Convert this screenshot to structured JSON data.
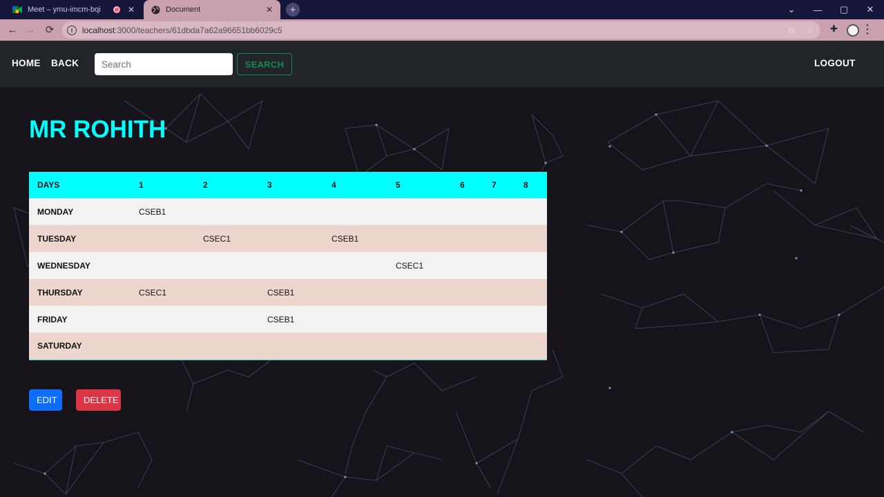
{
  "browser": {
    "tabs": [
      {
        "title": "Meet – ymu-imcm-bqi",
        "active": false
      },
      {
        "title": "Document",
        "active": true
      }
    ],
    "url_host": "localhost",
    "url_path": ":3000/teachers/61dbda7a62a96651bb6029c5"
  },
  "navbar": {
    "home": "HOME",
    "back": "BACK",
    "search_placeholder": "Search",
    "search_button": "SEARCH",
    "logout": "LOGOUT"
  },
  "page": {
    "title": "MR ROHITH"
  },
  "timetable": {
    "headers": [
      "DAYS",
      "1",
      "2",
      "3",
      "4",
      "5",
      "6",
      "7",
      "8"
    ],
    "rows": [
      {
        "day": "MONDAY",
        "periods": [
          "CSEB1",
          "",
          "",
          "",
          "",
          "",
          "",
          ""
        ]
      },
      {
        "day": "TUESDAY",
        "periods": [
          "",
          "CSEC1",
          "",
          "CSEB1",
          "",
          "",
          "",
          ""
        ]
      },
      {
        "day": "WEDNESDAY",
        "periods": [
          "",
          "",
          "",
          "",
          "CSEC1",
          "",
          "",
          ""
        ]
      },
      {
        "day": "THURSDAY",
        "periods": [
          "CSEC1",
          "",
          "CSEB1",
          "",
          "",
          "",
          "",
          ""
        ]
      },
      {
        "day": "FRIDAY",
        "periods": [
          "",
          "",
          "CSEB1",
          "",
          "",
          "",
          "",
          ""
        ]
      },
      {
        "day": "SATURDAY",
        "periods": [
          "",
          "",
          "",
          "",
          "",
          "",
          "",
          ""
        ]
      }
    ]
  },
  "actions": {
    "edit": "EDIT",
    "delete": "DELETE"
  },
  "colors": {
    "title": "#00ffff",
    "header_row": "#00ffff",
    "row_light": "#f2f2f2",
    "row_tint": "#ecd6cd",
    "edit": "#0d6efd",
    "delete": "#dc3545",
    "search_outline": "#198754"
  }
}
